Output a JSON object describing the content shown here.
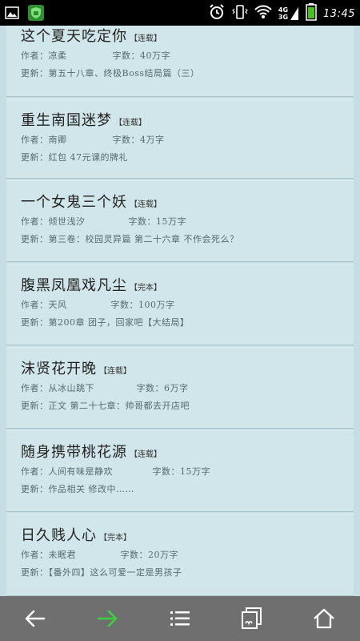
{
  "status_bar": {
    "time": "13:45",
    "network_top": "4G",
    "network_bottom": "3G"
  },
  "labels": {
    "author": "作者：",
    "words": "字数：",
    "update": "更新："
  },
  "books": [
    {
      "title": "这个夏天吃定你",
      "status": "【连载】",
      "author": "凉柔",
      "words": "40万字",
      "update": "第五十八章、终极Boss结局篇（三）"
    },
    {
      "title": "重生南国迷梦",
      "status": "【连载】",
      "author": "南卿",
      "words": "4万字",
      "update": "红包 47元课的牌礼"
    },
    {
      "title": "一个女鬼三个妖",
      "status": "【连载】",
      "author": "倾世浅汐",
      "words": "15万字",
      "update": "第三卷：校园灵异篇 第二十六章 不作会死么？"
    },
    {
      "title": "腹黑凤凰戏凡尘",
      "status": "【完本】",
      "author": "天风",
      "words": "100万字",
      "update": "第200章 团子，回家吧【大结局】"
    },
    {
      "title": "沫贤花开晚",
      "status": "【连载】",
      "author": "从冰山跳下",
      "words": "6万字",
      "update": "正文 第二十七章：帅哥都去开店吧"
    },
    {
      "title": "随身携带桃花源",
      "status": "【连载】",
      "author": "人间有味是静欢",
      "words": "15万字",
      "update": "作品相关 修改中……"
    },
    {
      "title": "日久贱人心",
      "status": "【完本】",
      "author": "未眠君",
      "words": "20万字",
      "update": "【番外四】这么可爱一定是男孩子"
    }
  ],
  "colors": {
    "accent_green": "#3bd23b",
    "battery_green": "#49c21c"
  }
}
